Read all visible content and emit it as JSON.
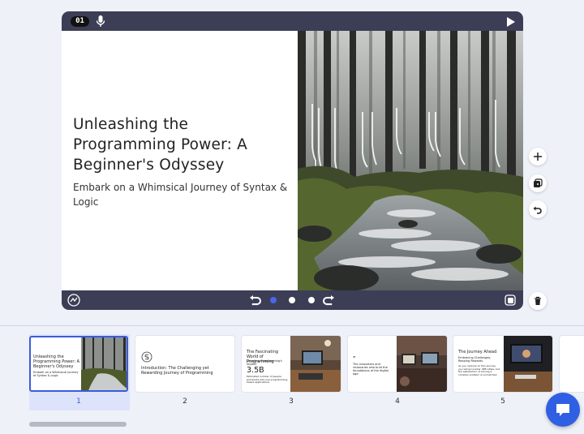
{
  "topbar": {
    "slide_number": "01",
    "mic_icon": "microphone-icon",
    "play_icon": "play-icon"
  },
  "slide": {
    "title": "Unleashing the Programming Power: A Beginner's Odyssey",
    "subtitle": "Embark on a Whimsical Journey of Syntax & Logic",
    "image": "misty forest stream photo"
  },
  "bottombar": {
    "left_icon": "ai-sparkle-icon",
    "undo_icon": "undo-icon",
    "redo_icon": "redo-icon",
    "dots": 3,
    "active_dot": 0,
    "right_icon": "layers-icon"
  },
  "tools": [
    "add-icon",
    "duplicate-icon",
    "undo-icon",
    "trash-icon"
  ],
  "thumbnails": [
    {
      "num": "1",
      "title": "Unleashing the Programming Power: A Beginner's Odyssey",
      "sub": "Embark on a Whimsical Journey of Syntax & Logic",
      "selected": true
    },
    {
      "num": "2",
      "title": "Introduction: The Challenging yet Rewarding Journey of Programming"
    },
    {
      "num": "3",
      "title": "The Fascinating World of Programming",
      "sub": "Unveiling Programming's Impact",
      "stat": "3.5B",
      "note": "Estimated number of people worldwide who use programming-based applications"
    },
    {
      "num": "4",
      "title": "The innovators and visionaries who built the foundations of the digital age."
    },
    {
      "num": "5",
      "title": "The Journey Ahead",
      "sub": "Embracing Challenges, Reaping Rewards",
      "note": "As you venture on this journey, you will encounter difficulties, but the satisfaction of solving a complex problem is unmatched."
    }
  ],
  "colors": {
    "frame": "#3b3e55",
    "accent": "#3d5bd9",
    "chat": "#2f5fe3"
  }
}
